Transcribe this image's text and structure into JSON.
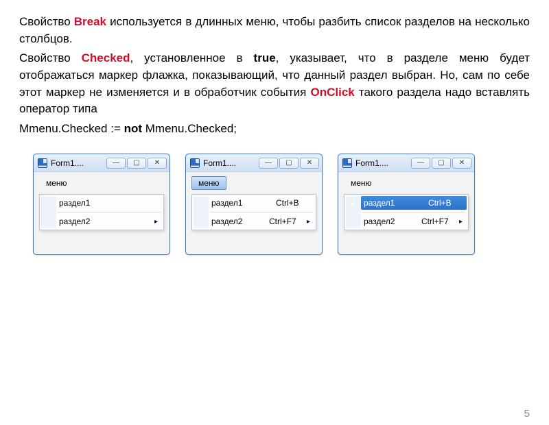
{
  "para1": {
    "pre": "Свойство ",
    "k1": "Break",
    "post": " используется в длинных меню, чтобы разбить список разделов на несколько столбцов."
  },
  "para2": {
    "pre": "Свойство ",
    "k1": "Checked",
    "mid1": ", установленное в ",
    "k2": "true",
    "mid2": ", указывает, что в разделе меню будет отображаться маркер флажка, показывающий, что данный раздел выбран. Но, сам по себе этот маркер не изменяется и в обработчик события ",
    "k3": "OnClick",
    "post": " такого раздела надо вставлять оператор типа"
  },
  "code": {
    "a": "Mmenu.Checked := ",
    "b": "not",
    "c": " Mmenu.Checked;"
  },
  "winTitle": "Form1....",
  "menuItem": "меню",
  "r1": "раздел1",
  "r2": "раздел2",
  "sc1": "Ctrl+B",
  "sc2": "Ctrl+F7",
  "minGlyph": "—",
  "maxGlyph": "▢",
  "closeGlyph": "✕",
  "arrow": "▸",
  "check": "✓",
  "slide": "5"
}
